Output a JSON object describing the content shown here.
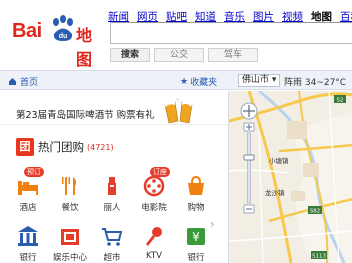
{
  "brand": {
    "logo_text_1": "Bai",
    "logo_text_2": "地图",
    "paw_label": "du"
  },
  "nav": [
    "新闻",
    "网页",
    "贴吧",
    "知道",
    "音乐",
    "图片",
    "视频",
    "地图",
    "百科"
  ],
  "nav_active_index": 7,
  "search": {
    "value": "",
    "buttons": [
      "搜索",
      "公交",
      "驾车"
    ]
  },
  "toolbar": {
    "home": "首页",
    "favorites": "收藏夹",
    "city": "佛山市",
    "weather": "阵雨 34~27°C"
  },
  "banner": {
    "text": "第23届青岛国际啤酒节 购票有礼"
  },
  "tuangou": {
    "logo": "团",
    "title": "热门团购",
    "count": "(4721)"
  },
  "categories": [
    {
      "label": "酒店",
      "icon": "hotel-icon",
      "tag": "预订"
    },
    {
      "label": "餐饮",
      "icon": "restaurant-icon",
      "tag": ""
    },
    {
      "label": "丽人",
      "icon": "beauty-icon",
      "tag": ""
    },
    {
      "label": "电影院",
      "icon": "cinema-icon",
      "tag": "订座"
    },
    {
      "label": "购物",
      "icon": "shopping-icon",
      "tag": ""
    },
    {
      "label": "银行",
      "icon": "bank-icon",
      "tag": ""
    },
    {
      "label": "娱乐中心",
      "icon": "entertainment-icon",
      "tag": ""
    },
    {
      "label": "超市",
      "icon": "supermarket-icon",
      "tag": ""
    },
    {
      "label": "KTV",
      "icon": "ktv-icon",
      "tag": ""
    },
    {
      "label": "银行",
      "icon": "atm-icon",
      "tag": ""
    }
  ],
  "map": {
    "labels": [
      "小塘镇",
      "龙沙镇",
      "S82",
      "S113",
      "S2"
    ]
  },
  "colors": {
    "brand_red": "#e1261c",
    "brand_blue": "#2a5db0",
    "link_blue": "#0000cc"
  }
}
